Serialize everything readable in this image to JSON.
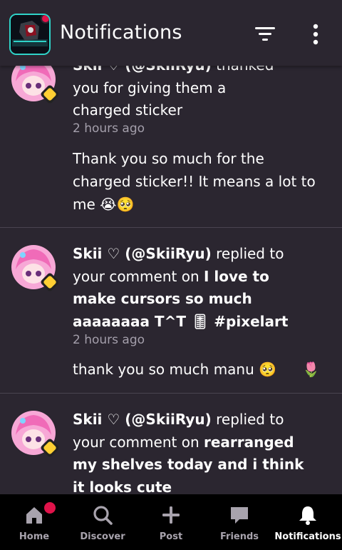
{
  "header": {
    "title": "Notifications",
    "filter_icon": "filter-icon",
    "more_icon": "more-vertical-icon"
  },
  "notifications": [
    {
      "author": "Skii ♡ (@SkiiRyu)",
      "action_line1_suffix": "thanked",
      "action_line2": "you for giving them a",
      "action_line3": "charged sticker",
      "time": "2 hours ago",
      "message_line1": "Thank you so much for the",
      "message_line2": "charged sticker!! It means a lot to",
      "message_line3": "me 😭🥺"
    },
    {
      "author": "Skii ♡ (@SkiiRyu)",
      "action": "replied to",
      "line2_prefix": "your comment on",
      "post_title_line1": "I love to",
      "post_title_line2": "make cursors so much",
      "post_title_line3": "aaaaaaaa T^T 🎚 #pixelart",
      "time": "2 hours ago",
      "message": "thank you so much manu 🥺",
      "message_emoji": "🌷"
    },
    {
      "author": "Skii ♡ (@SkiiRyu)",
      "action": "replied to",
      "line2_prefix": "your comment on",
      "post_title_line1": "rearranged",
      "post_title_line2": "my shelves today and i think",
      "post_title_line3": "it looks cute"
    }
  ],
  "nav": [
    {
      "label": "Home",
      "icon": "home-icon"
    },
    {
      "label": "Discover",
      "icon": "search-icon"
    },
    {
      "label": "Post",
      "icon": "plus-icon"
    },
    {
      "label": "Friends",
      "icon": "chat-icon"
    },
    {
      "label": "Notifications",
      "icon": "bell-icon",
      "active": true
    }
  ],
  "colors": {
    "background": "#2b2630",
    "divider": "#4a4450",
    "badge": "#e0134a",
    "muted_text": "#a49fab",
    "nav_background": "#000000"
  }
}
